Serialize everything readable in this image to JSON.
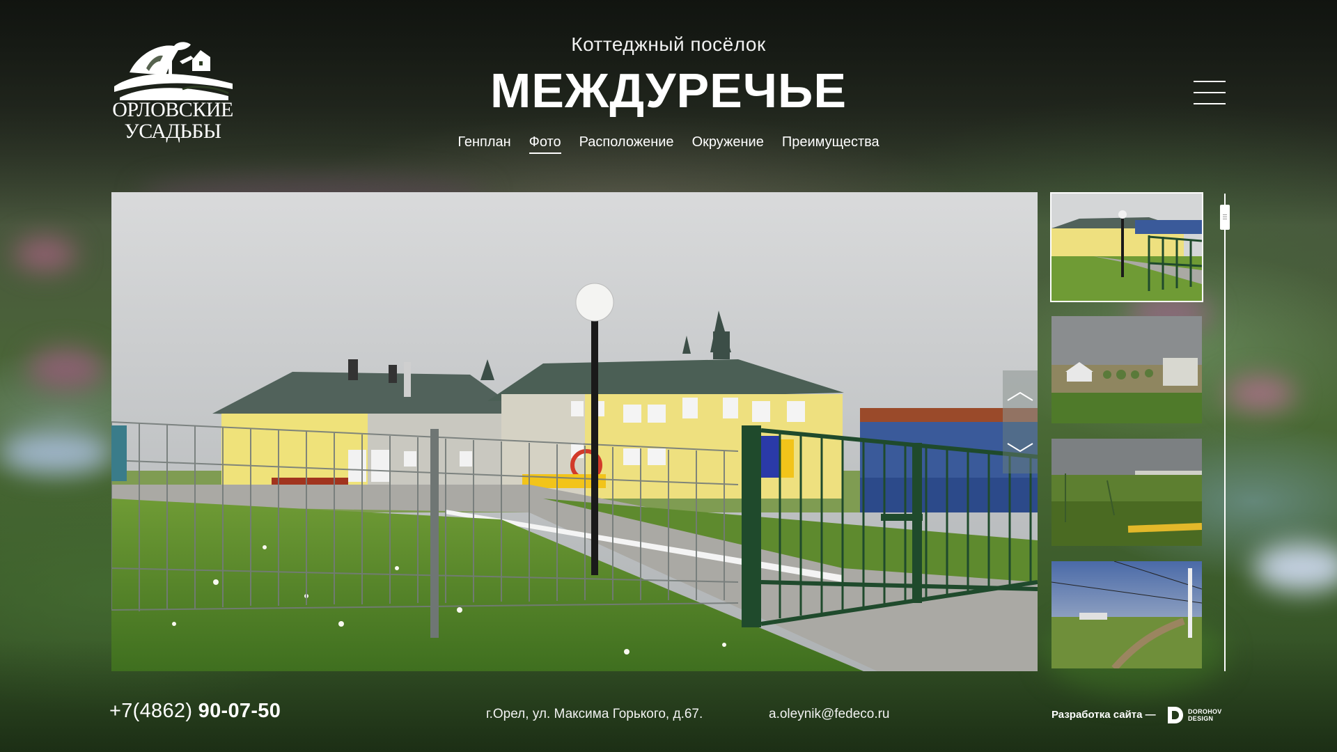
{
  "header": {
    "logo_line1": "ОРЛОВСКИЕ",
    "logo_line2": "УСАДЬБЫ",
    "subtitle": "Коттеджный посёлок",
    "title": "МЕЖДУРЕЧЬЕ"
  },
  "nav": {
    "items": [
      {
        "label": "Генплан"
      },
      {
        "label": "Фото",
        "active": true
      },
      {
        "label": "Расположение"
      },
      {
        "label": "Окружение"
      },
      {
        "label": "Преимущества"
      }
    ]
  },
  "gallery": {
    "selected_index": 0,
    "thumbnail_count": 4
  },
  "footer": {
    "phone_prefix": "+7(4862) ",
    "phone_number": "90-07-50",
    "address": "г.Орел, ул. Максима Горького, д.67.",
    "email": "a.oleynik@fedeco.ru",
    "developer_label": "Разработка сайта —",
    "developer_name_line1": "DOROHOV",
    "developer_name_line2": "DESIGN"
  },
  "colors": {
    "text": "#ffffff",
    "fence_green": "#1f4a2c",
    "roof_green": "#4b5f55",
    "wall_yellow": "#efe27a",
    "grass": "#6f9b35"
  },
  "icons": {
    "menu": "hamburger-icon",
    "prev": "chevron-up-icon",
    "next": "chevron-down-icon"
  }
}
